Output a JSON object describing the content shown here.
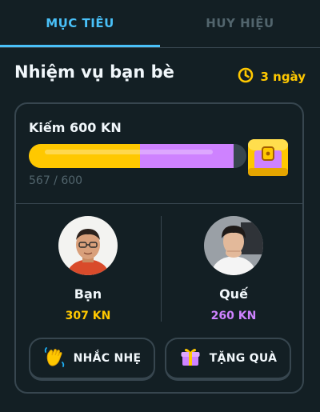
{
  "tabs": {
    "goals": "MỤC TIÊU",
    "badges": "HUY HIỆU"
  },
  "header": {
    "title": "Nhiệm vụ bạn bè",
    "days_left": "3 ngày"
  },
  "quest": {
    "title": "Kiếm 600 KN",
    "progress_text": "567 / 600",
    "you_fraction": 0.51,
    "friend_fraction": 0.43
  },
  "friends": [
    {
      "name": "Bạn",
      "xp": "307 KN",
      "xp_color": "#ffc800"
    },
    {
      "name": "Quế",
      "xp": "260 KN",
      "xp_color": "#ce82ff"
    }
  ],
  "actions": {
    "nudge": "NHẮC NHẸ",
    "gift": "TẶNG QUÀ"
  },
  "icons": {
    "timer": "timer-icon",
    "chest": "treasure-chest-icon",
    "wave": "waving-hand-icon",
    "gift": "gift-icon"
  },
  "colors": {
    "accent": "#49c0f8",
    "gold": "#ffc800",
    "purple": "#ce82ff"
  }
}
